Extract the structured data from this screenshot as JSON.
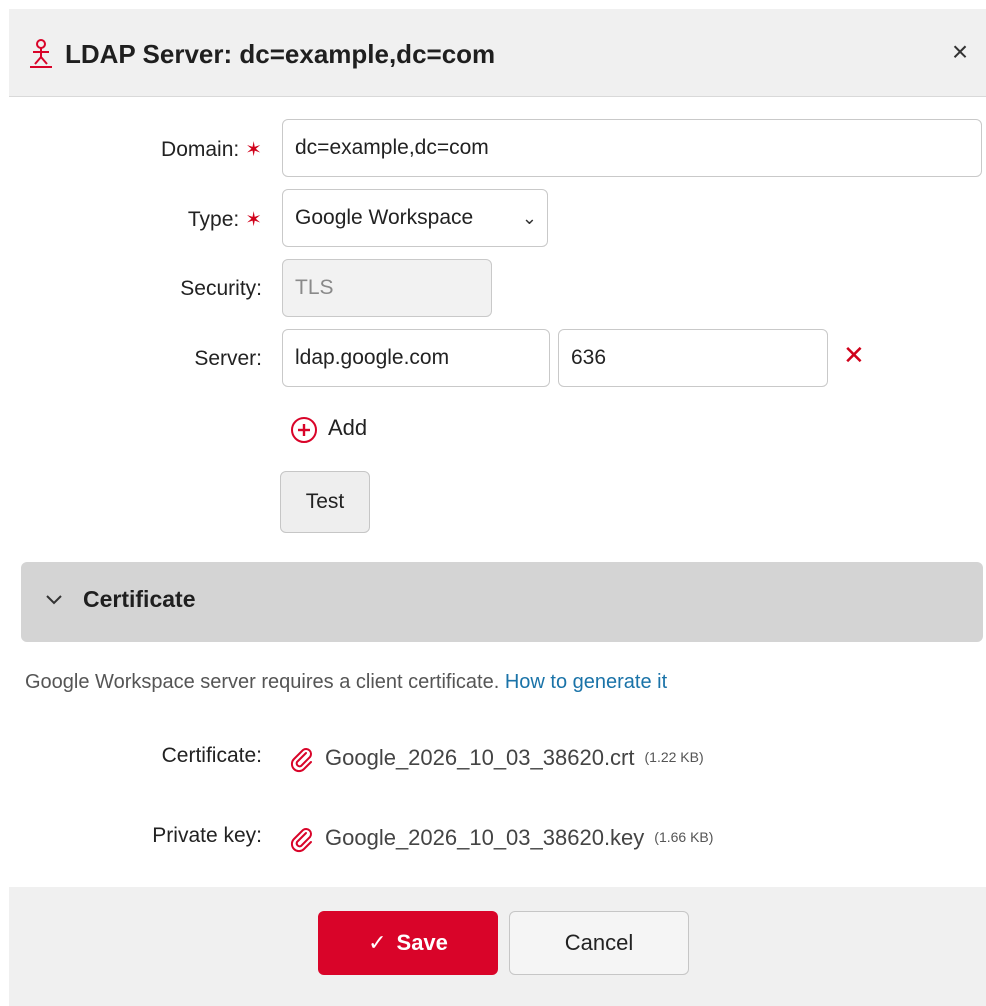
{
  "dialog": {
    "title": "LDAP Server: dc=example,dc=com",
    "close_label": "×"
  },
  "form": {
    "domain": {
      "label": "Domain:",
      "required_mark": "✶",
      "value": "dc=example,dc=com"
    },
    "type": {
      "label": "Type:",
      "required_mark": "✶",
      "value": "Google Workspace"
    },
    "security": {
      "label": "Security:",
      "value": "TLS"
    },
    "server": {
      "label": "Server:",
      "host": "ldap.google.com",
      "port": "636",
      "remove_label": "✕"
    },
    "add_label": "Add",
    "test_label": "Test"
  },
  "certificate_section": {
    "title": "Certificate",
    "info_text": "Google Workspace server requires a client certificate.",
    "info_link": "How to generate it",
    "certificate": {
      "label": "Certificate:",
      "file_name": "Google_2026_10_03_38620.crt",
      "file_size": "(1.22 KB)"
    },
    "private_key": {
      "label": "Private key:",
      "file_name": "Google_2026_10_03_38620.key",
      "file_size": "(1.66 KB)"
    }
  },
  "footer": {
    "save_label": "Save",
    "cancel_label": "Cancel"
  },
  "colors": {
    "accent": "#d90429",
    "link": "#1a73a8",
    "header_bg": "#f0f0f0",
    "section_bg": "#d4d4d4"
  }
}
